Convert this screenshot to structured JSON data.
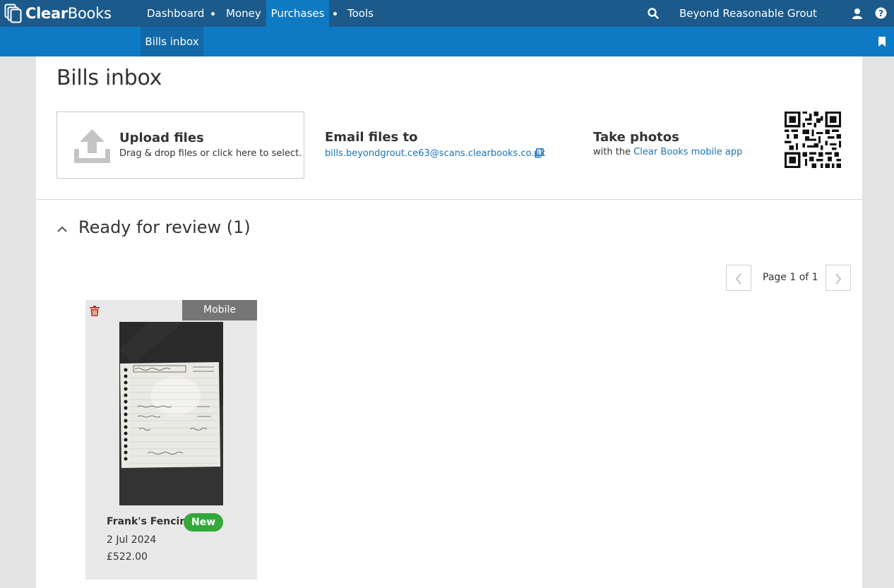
{
  "app": {
    "logo_text_bold": "Clear",
    "logo_text_rest": "Books"
  },
  "topnav": {
    "items": [
      {
        "label": "Dashboard"
      },
      {
        "label": "Money"
      },
      {
        "label": "Purchases",
        "active": true
      },
      {
        "label": "Tools"
      }
    ],
    "org_name": "Beyond Reasonable Grout",
    "icons": [
      "search-icon",
      "user-icon",
      "help-icon"
    ]
  },
  "subnav": {
    "items": [
      {
        "label": "Bills inbox",
        "active": true
      }
    ],
    "icons": [
      "bookmark-icon"
    ]
  },
  "page": {
    "title": "Bills inbox"
  },
  "upload": {
    "title": "Upload files",
    "subtitle": "Drag & drop files or click here to select."
  },
  "email": {
    "title": "Email files to",
    "address": "bills.beyondgrout.ce63@scans.clearbooks.co.uk"
  },
  "photos": {
    "title": "Take photos",
    "prefix": "with the ",
    "link": "Clear Books mobile app"
  },
  "review": {
    "title": "Ready for review (1)",
    "pager_text": "Page 1 of 1",
    "bills": [
      {
        "source": "Mobile",
        "vendor": "Frank's Fencing",
        "badge": "New",
        "date": "2 Jul 2024",
        "amount": "£522.00"
      }
    ]
  },
  "colors": {
    "topbar": "#1b5a8a",
    "subbar": "#0f7ac4",
    "link": "#1b72b8",
    "new_badge": "#34a83a",
    "trash": "#c0392b"
  }
}
